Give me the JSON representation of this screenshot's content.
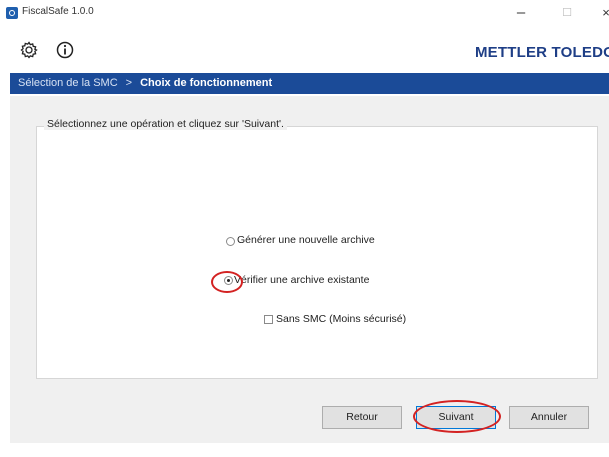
{
  "window": {
    "title": "FiscalSafe 1.0.0",
    "min_glyph": "–",
    "max_glyph": "☐",
    "close_glyph": "×"
  },
  "toolbar": {
    "brand": "METTLER TOLEDO",
    "settings_icon": "gear-icon",
    "info_icon": "info-icon"
  },
  "breadcrumb": {
    "step1": "Sélection de la SMC",
    "separator": ">",
    "step2": "Choix de fonctionnement"
  },
  "group": {
    "legend": "Sélectionnez une opération et cliquez sur 'Suivant'."
  },
  "options": {
    "new_archive": "Générer une nouvelle archive",
    "verify_archive": "Vérifier une archive existante",
    "without_smc": "Sans SMC (Moins sécurisé)",
    "selected": "verify_archive",
    "without_smc_checked": false
  },
  "buttons": {
    "back": "Retour",
    "next": "Suivant",
    "cancel": "Annuler"
  },
  "colors": {
    "breadcrumb_bg": "#1b4b98",
    "brand": "#1e3e86",
    "annotation": "#d32222"
  }
}
